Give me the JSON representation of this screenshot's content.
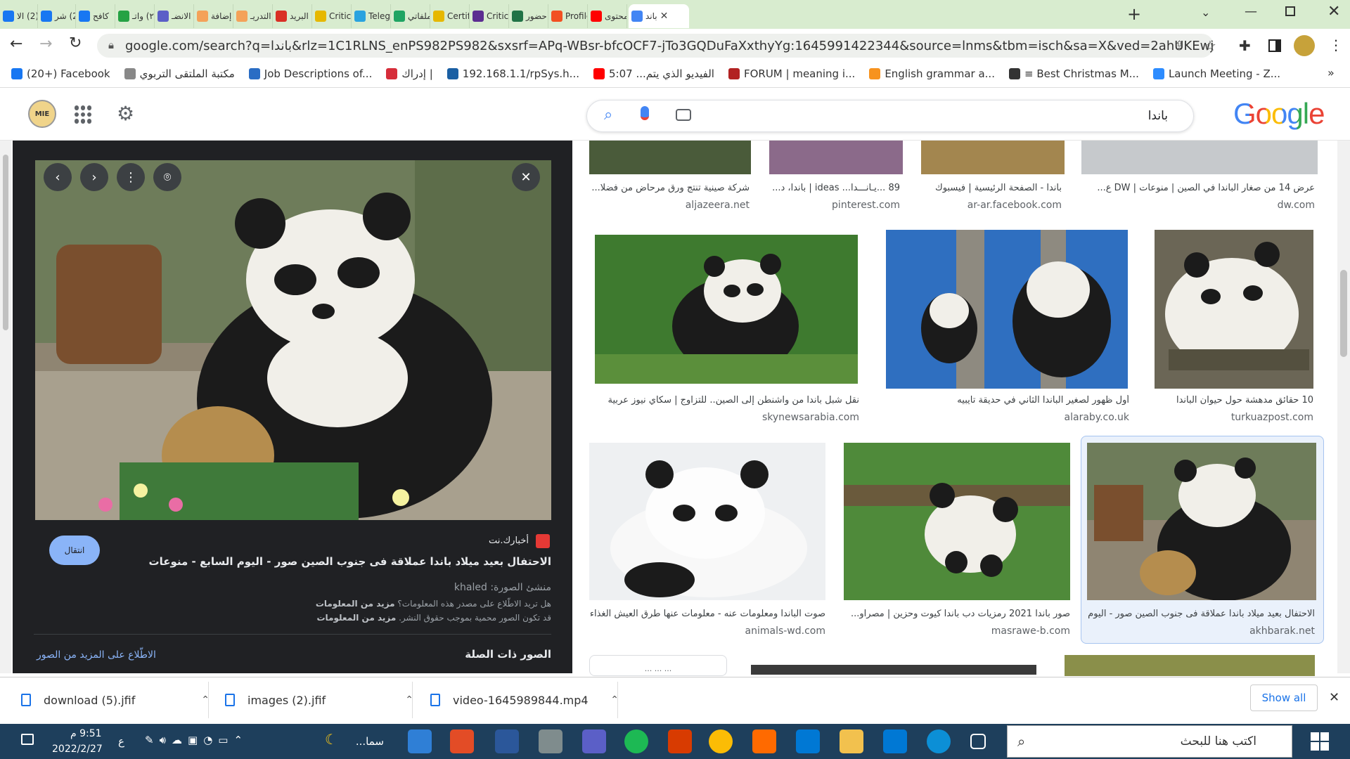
{
  "browser": {
    "tabs": [
      {
        "label": "(2) الا",
        "color": "#1877f2"
      },
      {
        "label": "(2) شر",
        "color": "#1877f2"
      },
      {
        "label": "كافح",
        "color": "#1877f2"
      },
      {
        "label": "(٢) واتـ",
        "color": "#25a244"
      },
      {
        "label": "الانضـ",
        "color": "#5b5fc7"
      },
      {
        "label": "إضافة",
        "color": "#f4a259"
      },
      {
        "label": "التدريـ",
        "color": "#f4a259"
      },
      {
        "label": "البريد",
        "color": "#d93025"
      },
      {
        "label": "Critica",
        "color": "#e6b800"
      },
      {
        "label": "Telegr",
        "color": "#2aa3df"
      },
      {
        "label": "ملفاتي",
        "color": "#1fa463"
      },
      {
        "label": "Certifi",
        "color": "#e6b800"
      },
      {
        "label": "Critica",
        "color": "#5c2d91"
      },
      {
        "label": "حضور",
        "color": "#217346"
      },
      {
        "label": "Profile",
        "color": "#f25022"
      },
      {
        "label": "محتوى",
        "color": "#ff0000"
      },
      {
        "label": "باند",
        "color": "#4285f4"
      }
    ],
    "url": "google.com/search?q=باندا&rlz=1C1RLNS_enPS982PS982&sxsrf=APq-WBsr-bfcOCF7-jTo3GQDuFaXxthyYg:1645991422344&source=lnms&tbm=isch&sa=X&ved=2ahUKEwjLtKDw06D2AhUW...",
    "bookmarks": [
      {
        "label": "(20+) Facebook",
        "color": "#1877f2"
      },
      {
        "label": "مكتبة الملتقى التربوي",
        "color": "#888"
      },
      {
        "label": "Job Descriptions of...",
        "color": "#2a6dc4"
      },
      {
        "label": "إدراك |",
        "color": "#d62d3a"
      },
      {
        "label": "192.168.1.1/rpSys.h...",
        "color": "#1a5fa3"
      },
      {
        "label": "الفيديو الذي يتم... 5:07",
        "color": "#ff0000"
      },
      {
        "label": "FORUM | meaning i...",
        "color": "#b22222"
      },
      {
        "label": "English grammar a...",
        "color": "#f7931e"
      },
      {
        "label": "≡ Best Christmas M...",
        "color": "#333"
      },
      {
        "label": "Launch Meeting - Z...",
        "color": "#2d8cff"
      }
    ]
  },
  "google": {
    "logo": "Google",
    "query": "باندا",
    "avatar_text": "MIE"
  },
  "panel": {
    "site": "أخبارك.نت",
    "title": "الاحتفال بعيد ميلاد باندا عملاقة فى جنوب الصين صور - اليوم السابع - منوعات",
    "visit": "انتقال",
    "creator_label": "منشئ الصورة:",
    "creator": "khaled",
    "feedback": "هل تريد الاطّلاع على مصدر هذه المعلومات؟",
    "more_info": "مزيد من المعلومات",
    "copyright": "قد تكون الصور محمية بموجب حقوق النشر.",
    "more_info2": "مزيد من المعلومات",
    "related": "الصور ذات الصلة",
    "see_more": "الاطّلاع على المزيد من الصور"
  },
  "results": {
    "row0": [
      {
        "cap": "شركة صينية تنتج ورق مرحاض من فضلا...",
        "src": "aljazeera.net"
      },
      {
        "cap": "89 ...يـانـــدا... ideas | باندا، د...",
        "src": "pinterest.com"
      },
      {
        "cap": "باندا - الصفحة الرئيسية | فيسبوك",
        "src": "ar-ar.facebook.com"
      },
      {
        "cap": "عرض 14 من صغار الباندا في الصين | منوعات | DW ع...",
        "src": "dw.com"
      }
    ],
    "row1": [
      {
        "cap": "نقل شبل باندا من واشنطن إلى الصين.. للتزاوج | سكاي نيوز عربية",
        "src": "skynewsarabia.com"
      },
      {
        "cap": "أول ظهور لصغير الباندا الثاني في حديقة تايبيه",
        "src": "alaraby.co.uk"
      },
      {
        "cap": "10 حقائق مدهشة حول حيوان الباندا",
        "src": "turkuazpost.com"
      }
    ],
    "row2": [
      {
        "cap": "صوت الباندا ومعلومات عنه - معلومات عنها طرق العيش الغذاء ...",
        "src": "animals-wd.com"
      },
      {
        "cap": "صور باندا 2021 رمزيات دب باندا كيوت وحزين | مصراو...",
        "src": "masrawe-b.com"
      },
      {
        "cap": "الاحتفال بعيد ميلاد باندا عملاقة فى جنوب الصين صور - اليوم...",
        "src": "akhbarak.net"
      }
    ],
    "partial_label": "... ... ..."
  },
  "downloads": [
    {
      "name": "download (5).jfif"
    },
    {
      "name": "images (2).jfif"
    },
    {
      "name": "video-1645989844.mp4"
    }
  ],
  "downloads_show_all": "Show all",
  "taskbar": {
    "search_placeholder": "اكتب هنا للبحث",
    "time": "9:51 م",
    "date": "2022/2/27",
    "lang": "ع",
    "weather": "سما..."
  }
}
